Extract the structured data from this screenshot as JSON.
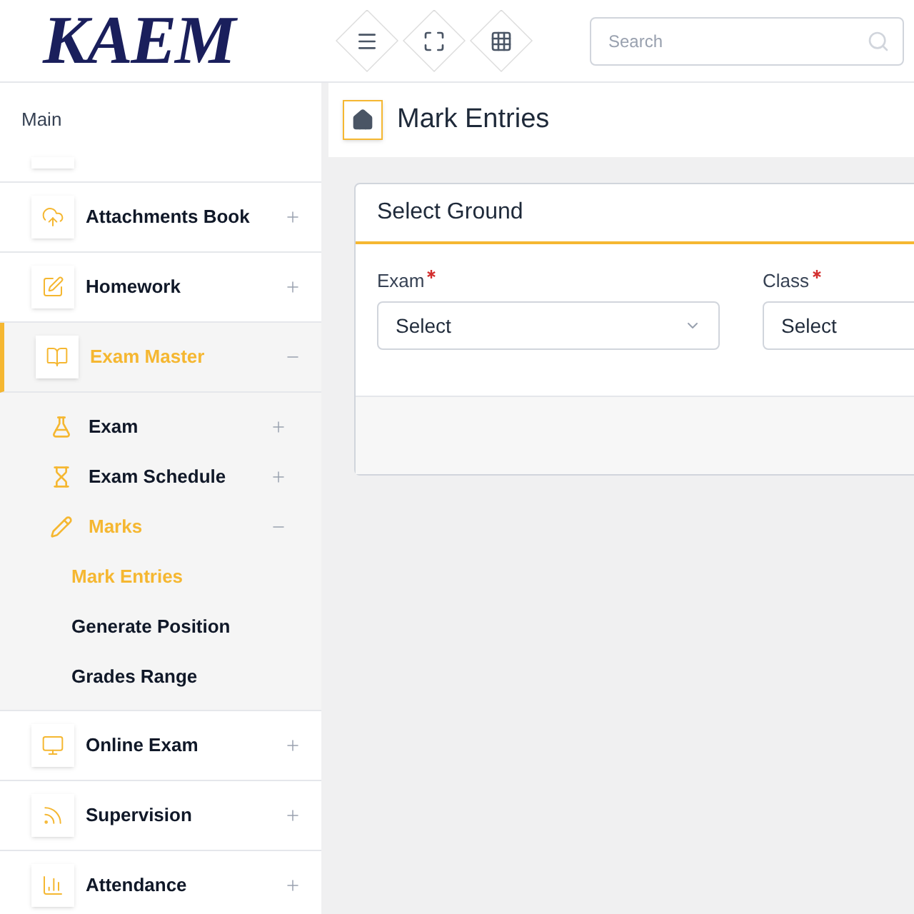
{
  "header": {
    "logo": "KAEM",
    "search": {
      "placeholder": "Search"
    }
  },
  "sidebar": {
    "section_label": "Main",
    "items": [
      {
        "label": "Attachments Book",
        "expanded": false,
        "selected": false
      },
      {
        "label": "Homework",
        "expanded": false,
        "selected": false
      },
      {
        "label": "Exam Master",
        "expanded": true,
        "selected": true,
        "children": [
          {
            "label": "Exam",
            "expanded": false,
            "selected": false
          },
          {
            "label": "Exam Schedule",
            "expanded": false,
            "selected": false
          },
          {
            "label": "Marks",
            "expanded": true,
            "selected": true,
            "children": [
              {
                "label": "Mark Entries",
                "selected": true
              },
              {
                "label": "Generate Position",
                "selected": false
              },
              {
                "label": "Grades Range",
                "selected": false
              }
            ]
          }
        ]
      },
      {
        "label": "Online Exam",
        "expanded": false,
        "selected": false
      },
      {
        "label": "Supervision",
        "expanded": false,
        "selected": false
      },
      {
        "label": "Attendance",
        "expanded": false,
        "selected": false
      }
    ]
  },
  "page": {
    "title": "Mark Entries"
  },
  "card": {
    "title": "Select Ground",
    "fields": [
      {
        "label": "Exam",
        "required": true,
        "placeholder": "Select"
      },
      {
        "label": "Class",
        "required": true,
        "placeholder": "Select"
      }
    ]
  }
}
